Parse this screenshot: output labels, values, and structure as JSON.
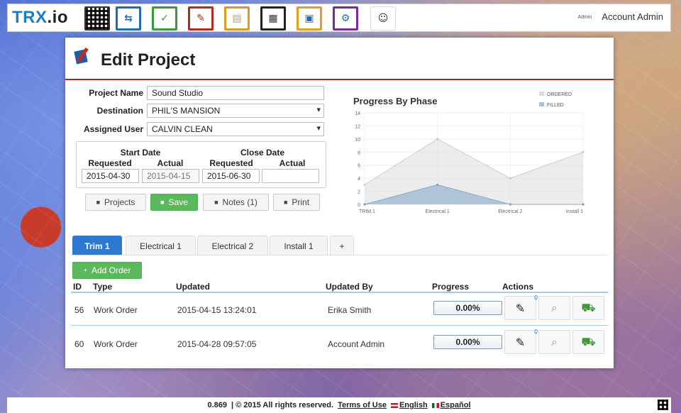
{
  "brand": {
    "name_main": "TRX",
    "name_ext": ".io"
  },
  "nav": {
    "icons": [
      {
        "name": "qr-code-icon",
        "border": "#333333"
      },
      {
        "name": "transfer-icon",
        "border": "#1c6fb5"
      },
      {
        "name": "checklist-icon",
        "border": "#3c9a3c"
      },
      {
        "name": "edit-project-icon",
        "border": "#b52a1a"
      },
      {
        "name": "orders-icon",
        "border": "#e09a20"
      },
      {
        "name": "reports-icon",
        "border": "#222222"
      },
      {
        "name": "gallery-icon",
        "border": "#e0a020"
      },
      {
        "name": "settings-icon",
        "border": "#7a2a9a"
      },
      {
        "name": "user-icon",
        "border": "#dddddd"
      }
    ],
    "user_small": "Admin",
    "user_name": "Account Admin"
  },
  "page": {
    "title": "Edit Project"
  },
  "form": {
    "project_name_label": "Project Name",
    "project_name_value": "Sound Studio",
    "destination_label": "Destination",
    "destination_value": "PHIL'S MANSION",
    "assigned_user_label": "Assigned User",
    "assigned_user_value": "CALVIN CLEAN",
    "start_date_label": "Start Date",
    "close_date_label": "Close Date",
    "requested_label": "Requested",
    "actual_label": "Actual",
    "start_requested": "2015-04-30",
    "start_actual": "2015-04-15",
    "close_requested": "2015-06-30",
    "close_actual": ""
  },
  "buttons": {
    "projects": "Projects",
    "save": "Save",
    "notes": "Notes (1)",
    "print": "Print"
  },
  "chart_data": {
    "type": "area",
    "title": "Progress By Phase",
    "categories": [
      "TRIM 1",
      "Electrical 1",
      "Electrical 2",
      "Install 1"
    ],
    "series": [
      {
        "name": "ORDERED",
        "values": [
          3,
          10,
          4,
          8
        ],
        "color": "#dcdcdc"
      },
      {
        "name": "FILLED",
        "values": [
          0,
          3,
          0,
          0
        ],
        "color": "#a9c0d6"
      }
    ],
    "ylim": [
      0,
      14
    ],
    "yticks": [
      0,
      2,
      4,
      6,
      8,
      10,
      12,
      14
    ],
    "grid": true,
    "legend_position": "top-right"
  },
  "tabs": [
    {
      "label": "Trim 1",
      "active": true
    },
    {
      "label": "Electrical 1",
      "active": false
    },
    {
      "label": "Electrical 2",
      "active": false
    },
    {
      "label": "Install 1",
      "active": false
    },
    {
      "label": "+",
      "active": false
    }
  ],
  "orders": {
    "add_label": "Add Order",
    "headers": {
      "id": "ID",
      "type": "Type",
      "updated": "Updated",
      "updated_by": "Updated By",
      "progress": "Progress",
      "actions": "Actions"
    },
    "rows": [
      {
        "id": "56",
        "type": "Work Order",
        "updated": "2015-04-15 13:24:01",
        "updated_by": "Erika Smith",
        "progress": "0.00%",
        "badge": "0"
      },
      {
        "id": "60",
        "type": "Work Order",
        "updated": "2015-04-28 09:57:05",
        "updated_by": "Account Admin",
        "progress": "0.00%",
        "badge": "0"
      }
    ]
  },
  "footer": {
    "version": "0.869",
    "copyright": "| © 2015 All rights reserved.",
    "terms": "Terms of Use",
    "english": "English",
    "espanol": "Español"
  }
}
